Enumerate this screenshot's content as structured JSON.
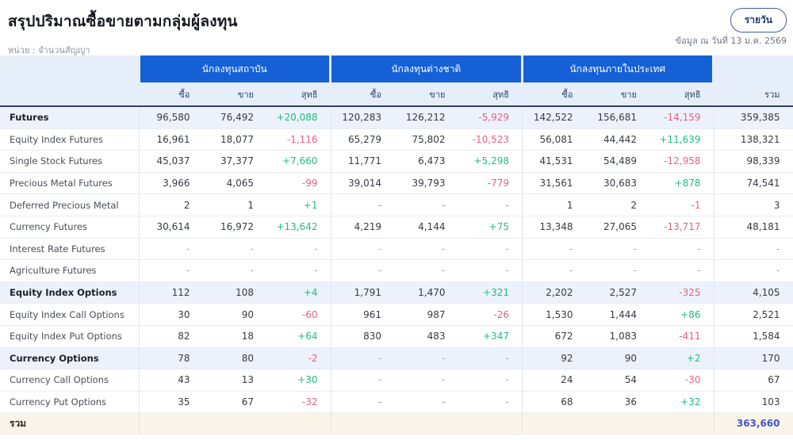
{
  "page": {
    "title": "สรุปปริมาณซื้อขายตามกลุ่มผู้ลงทุน",
    "unit_label": "หน่วย : จำนวนสัญญา",
    "as_of_label": "ข้อมูล ณ วันที่ 13 ม.ค. 2569",
    "period_button_label": "รายวัน"
  },
  "table": {
    "investor_groups": [
      {
        "label": "นักลงทุนสถาบัน"
      },
      {
        "label": "นักลงทุนต่างชาติ"
      },
      {
        "label": "นักลงทุนภายในประเทศ"
      }
    ],
    "sub_headers": {
      "buy": "ซื้อ",
      "sell": "ขาย",
      "net": "สุทธิ"
    },
    "total_column_header": "รวม",
    "rows": [
      {
        "label": "Futures",
        "emphasis": true,
        "cells": [
          "96,580",
          "76,492",
          "+20,088",
          "120,283",
          "126,212",
          "-5,929",
          "142,522",
          "156,681",
          "-14,159",
          "359,385"
        ]
      },
      {
        "label": "Equity Index Futures",
        "emphasis": false,
        "cells": [
          "16,961",
          "18,077",
          "-1,116",
          "65,279",
          "75,802",
          "-10,523",
          "56,081",
          "44,442",
          "+11,639",
          "138,321"
        ]
      },
      {
        "label": "Single Stock Futures",
        "emphasis": false,
        "cells": [
          "45,037",
          "37,377",
          "+7,660",
          "11,771",
          "6,473",
          "+5,298",
          "41,531",
          "54,489",
          "-12,958",
          "98,339"
        ]
      },
      {
        "label": "Precious Metal Futures",
        "emphasis": false,
        "cells": [
          "3,966",
          "4,065",
          "-99",
          "39,014",
          "39,793",
          "-779",
          "31,561",
          "30,683",
          "+878",
          "74,541"
        ]
      },
      {
        "label": "Deferred Precious Metal",
        "emphasis": false,
        "cells": [
          "2",
          "1",
          "+1",
          "-",
          "-",
          "-",
          "1",
          "2",
          "-1",
          "3"
        ]
      },
      {
        "label": "Currency Futures",
        "emphasis": false,
        "cells": [
          "30,614",
          "16,972",
          "+13,642",
          "4,219",
          "4,144",
          "+75",
          "13,348",
          "27,065",
          "-13,717",
          "48,181"
        ]
      },
      {
        "label": "Interest Rate Futures",
        "emphasis": false,
        "cells": [
          "-",
          "-",
          "-",
          "-",
          "-",
          "-",
          "-",
          "-",
          "-",
          "-"
        ]
      },
      {
        "label": "Agriculture Futures",
        "emphasis": false,
        "cells": [
          "-",
          "-",
          "-",
          "-",
          "-",
          "-",
          "-",
          "-",
          "-",
          "-"
        ]
      },
      {
        "label": "Equity Index Options",
        "emphasis": true,
        "cells": [
          "112",
          "108",
          "+4",
          "1,791",
          "1,470",
          "+321",
          "2,202",
          "2,527",
          "-325",
          "4,105"
        ]
      },
      {
        "label": "Equity Index Call Options",
        "emphasis": false,
        "cells": [
          "30",
          "90",
          "-60",
          "961",
          "987",
          "-26",
          "1,530",
          "1,444",
          "+86",
          "2,521"
        ]
      },
      {
        "label": "Equity Index Put Options",
        "emphasis": false,
        "cells": [
          "82",
          "18",
          "+64",
          "830",
          "483",
          "+347",
          "672",
          "1,083",
          "-411",
          "1,584"
        ]
      },
      {
        "label": "Currency Options",
        "emphasis": true,
        "cells": [
          "78",
          "80",
          "-2",
          "-",
          "-",
          "-",
          "92",
          "90",
          "+2",
          "170"
        ]
      },
      {
        "label": "Currency Call Options",
        "emphasis": false,
        "cells": [
          "43",
          "13",
          "+30",
          "-",
          "-",
          "-",
          "24",
          "54",
          "-30",
          "67"
        ]
      },
      {
        "label": "Currency Put Options",
        "emphasis": false,
        "cells": [
          "35",
          "67",
          "-32",
          "-",
          "-",
          "-",
          "68",
          "36",
          "+32",
          "103"
        ]
      }
    ],
    "total_row": {
      "label": "รวม",
      "grand_total": "363,660"
    }
  },
  "colors": {
    "group_header_bg": "#1560d6",
    "positive": "#1fbe7e",
    "negative": "#ec5f7d",
    "grand_total_text": "#4156c6"
  }
}
